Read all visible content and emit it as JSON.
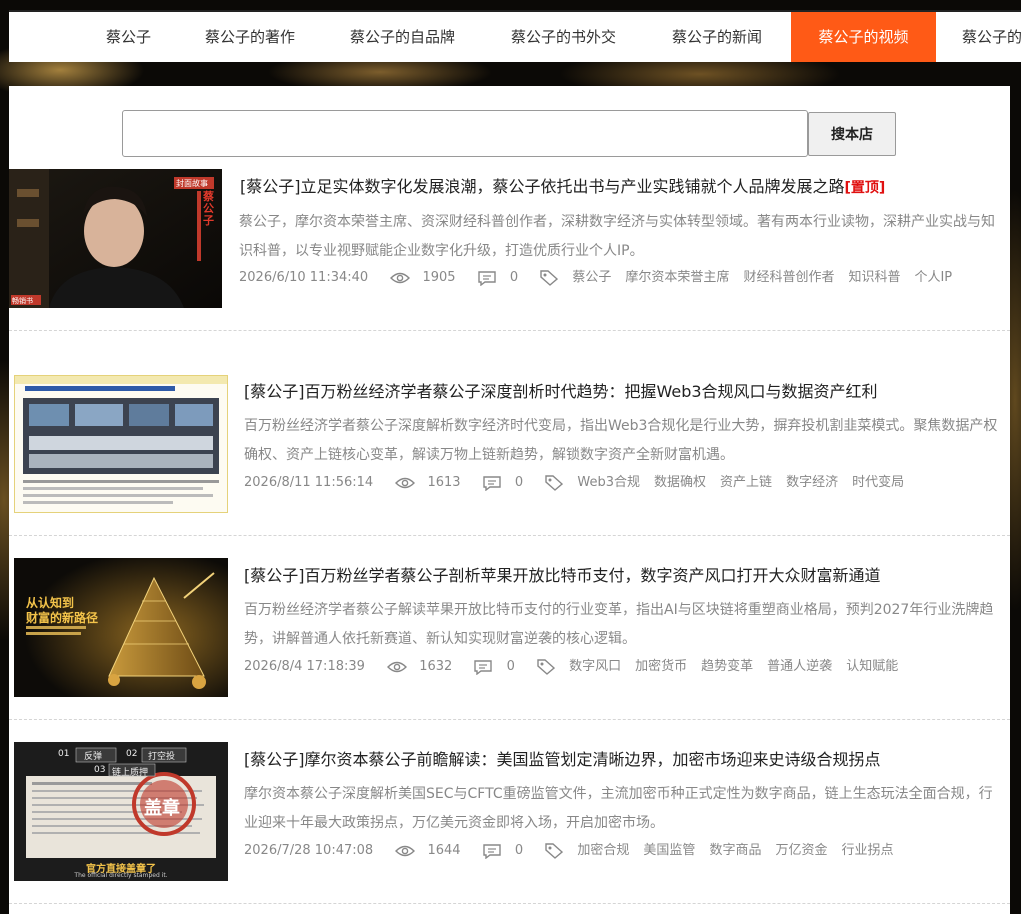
{
  "nav": {
    "items": [
      {
        "label": "蔡公子"
      },
      {
        "label": "蔡公子的著作"
      },
      {
        "label": "蔡公子的自品牌"
      },
      {
        "label": "蔡公子的书外交"
      },
      {
        "label": "蔡公子的新闻"
      },
      {
        "label": "蔡公子的视频",
        "active": true
      },
      {
        "label": "蔡公子的"
      }
    ],
    "active_color": "#ff5a16"
  },
  "search": {
    "value": "",
    "placeholder": "",
    "button_label": "搜本店"
  },
  "articles": [
    {
      "title": "[蔡公子]立足实体数字化发展浪潮，蔡公子依托出书与产业实践铺就个人品牌发展之路",
      "pin_label": "[置顶]",
      "summary": "蔡公子，摩尔资本荣誉主席、资深财经科普创作者，深耕数字经济与实体转型领域。著有两本行业读物，深耕产业实战与知识科普，以专业视野赋能企业数字化升级，打造优质行业个人IP。",
      "date": "2026/6/10 11:34:40",
      "views": "1905",
      "comments": "0",
      "tags": [
        "蔡公子",
        "摩尔资本荣誉主席",
        "财经科普创作者",
        "知识科普",
        "个人IP"
      ],
      "thumb_text": [
        "封面故事",
        "蔡公子",
        "畅销书"
      ]
    },
    {
      "title": "[蔡公子]百万粉丝经济学者蔡公子深度剖析时代趋势：把握Web3合规风口与数据资产红利",
      "summary": "百万粉丝经济学者蔡公子深度解析数字经济时代变局，指出Web3合规化是行业大势，摒弃投机割韭菜模式。聚焦数据产权确权、资产上链核心变革，解读万物上链新趋势，解锁数字资产全新财富机遇。",
      "date": "2026/8/11 11:56:14",
      "views": "1613",
      "comments": "0",
      "tags": [
        "Web3合规",
        "数据确权",
        "资产上链",
        "数字经济",
        "时代变局"
      ]
    },
    {
      "title": "[蔡公子]百万粉丝学者蔡公子剖析苹果开放比特币支付，数字资产风口打开大众财富新通道",
      "summary": "百万粉丝经济学者蔡公子解读苹果开放比特币支付的行业变革，指出AI与区块链将重塑商业格局，预判2027年行业洗牌趋势，讲解普通人依托新赛道、新认知实现财富逆袭的核心逻辑。",
      "date": "2026/8/4 17:18:39",
      "views": "1632",
      "comments": "0",
      "tags": [
        "数字风口",
        "加密货币",
        "趋势变革",
        "普通人逆袭",
        "认知赋能"
      ],
      "thumb_text": [
        "从认知到",
        "财富的新路径"
      ]
    },
    {
      "title": "[蔡公子]摩尔资本蔡公子前瞻解读：美国监管划定清晰边界，加密市场迎来史诗级合规拐点",
      "summary": "摩尔资本蔡公子深度解析美国SEC与CFTC重磅监管文件，主流加密币种正式定性为数字商品，链上生态玩法全面合规，行业迎来十年最大政策拐点，万亿美元资金即将入场，开启加密市场。",
      "date": "2026/7/28 10:47:08",
      "views": "1644",
      "comments": "0",
      "tags": [
        "加密合规",
        "美国监管",
        "数字商品",
        "万亿资金",
        "行业拐点"
      ],
      "thumb_text": [
        "01",
        "反弹",
        "02",
        "打空投",
        "03",
        "链上质押",
        "盖章",
        "官方直接盖章了",
        "The official directly stamped it."
      ]
    }
  ],
  "colors": {
    "accent": "#ff5a16",
    "pin": "#e01010",
    "meta_text": "#888888",
    "title_text": "#222222"
  },
  "icons": {
    "views": "eye-icon",
    "comments": "comment-icon",
    "tags": "tag-icon"
  }
}
